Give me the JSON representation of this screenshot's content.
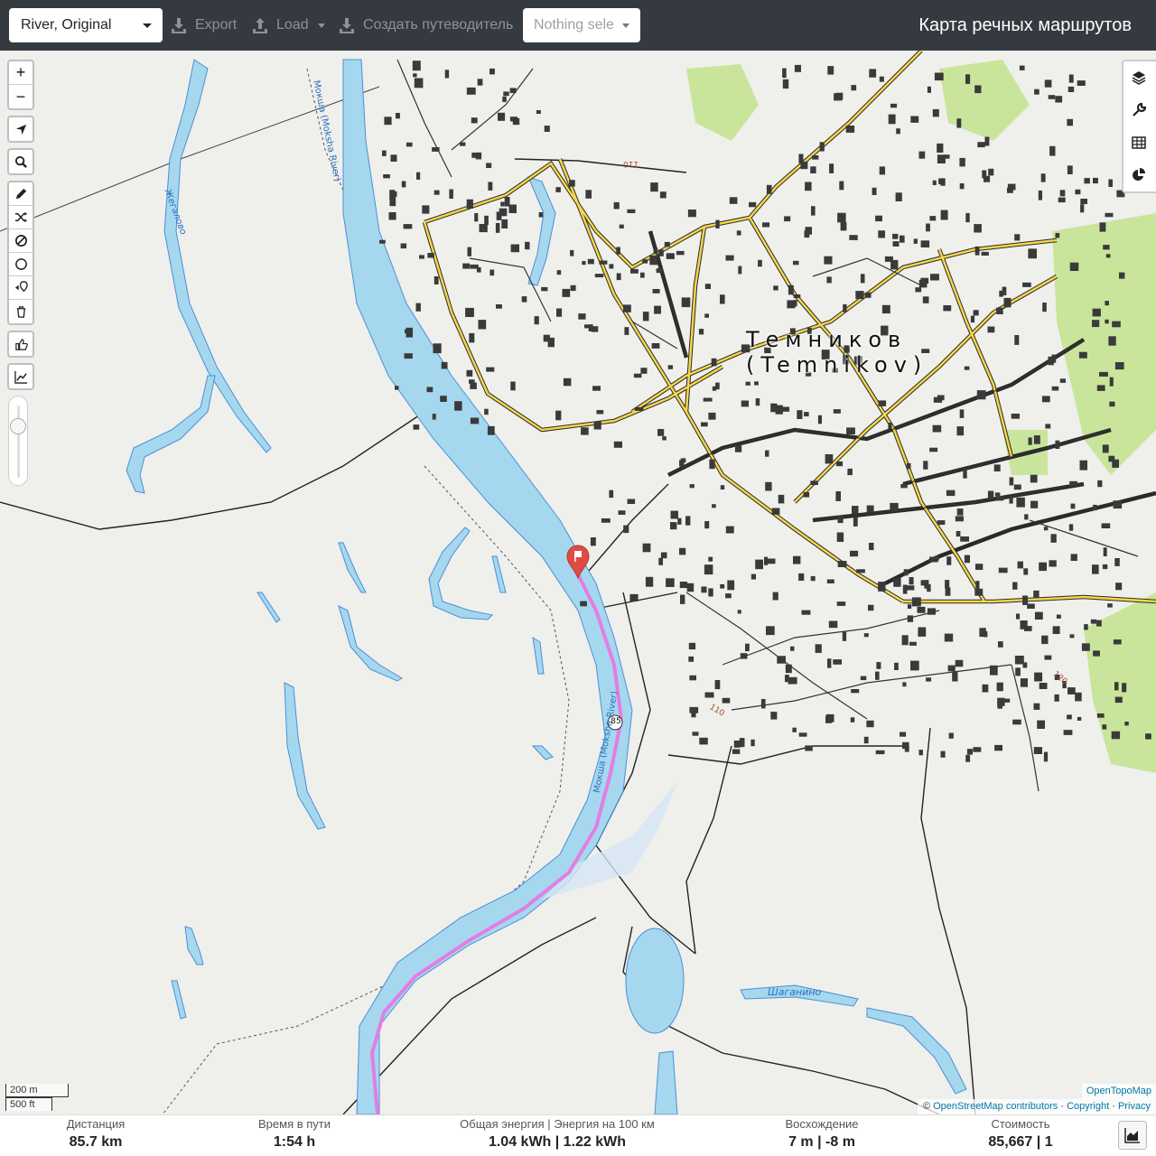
{
  "toolbar": {
    "profile": "River, Original",
    "export_label": "Export",
    "load_label": "Load",
    "guide_label": "Создать путеводитель",
    "selection_placeholder": "Nothing sele",
    "app_title": "Карта речных маршрутов"
  },
  "map": {
    "city_name": "Темников",
    "city_name_latin": "(Temnikov)",
    "river_label": "Мокша (Moksha River)",
    "river_label_lower": "Мокша (Moksha River)",
    "lake_label": "Шаганино",
    "stream_label": "Жегалово",
    "km_marker": "85",
    "contour_labels": [
      "110",
      "110",
      "120"
    ],
    "scale_metric": "200 m",
    "scale_imperial": "500 ft",
    "attribution_layer": "OpenTopoMap",
    "attribution_prefix": "©",
    "attribution_osm": "OpenStreetMap contributors",
    "attribution_copyright": "Copyright",
    "attribution_privacy": "Privacy",
    "colors": {
      "water": "#a5d8ee",
      "water_line": "#4a8fd6",
      "route": "#e27ee3",
      "road": "#f5d64a",
      "forest": "#c9e59b",
      "topbar": "#343a40",
      "marker": "#e04b45"
    }
  },
  "left_controls": {
    "zoom": [
      "+",
      "−"
    ],
    "icons": [
      "locate-icon",
      "search-icon",
      "pencil-icon",
      "shuffle-icon",
      "no-entry-icon",
      "circle-icon",
      "waypoint-icon",
      "trash-icon",
      "thumb-icon",
      "chart-line-icon"
    ]
  },
  "right_controls": [
    "layers-icon",
    "wrench-icon",
    "table-icon",
    "pie-chart-icon"
  ],
  "stats": {
    "distance": {
      "label": "Дистанция",
      "value": "85.7 km"
    },
    "time": {
      "label": "Время в пути",
      "value": "1:54 h"
    },
    "energy": {
      "label": "Общая энергия | Энергия на 100 км",
      "value": "1.04 kWh | 1.22 kWh"
    },
    "elevation": {
      "label": "Восхождение",
      "value": "7 m | -8 m"
    },
    "cost": {
      "label": "Стоимость",
      "value": "85,667 | 1"
    }
  }
}
